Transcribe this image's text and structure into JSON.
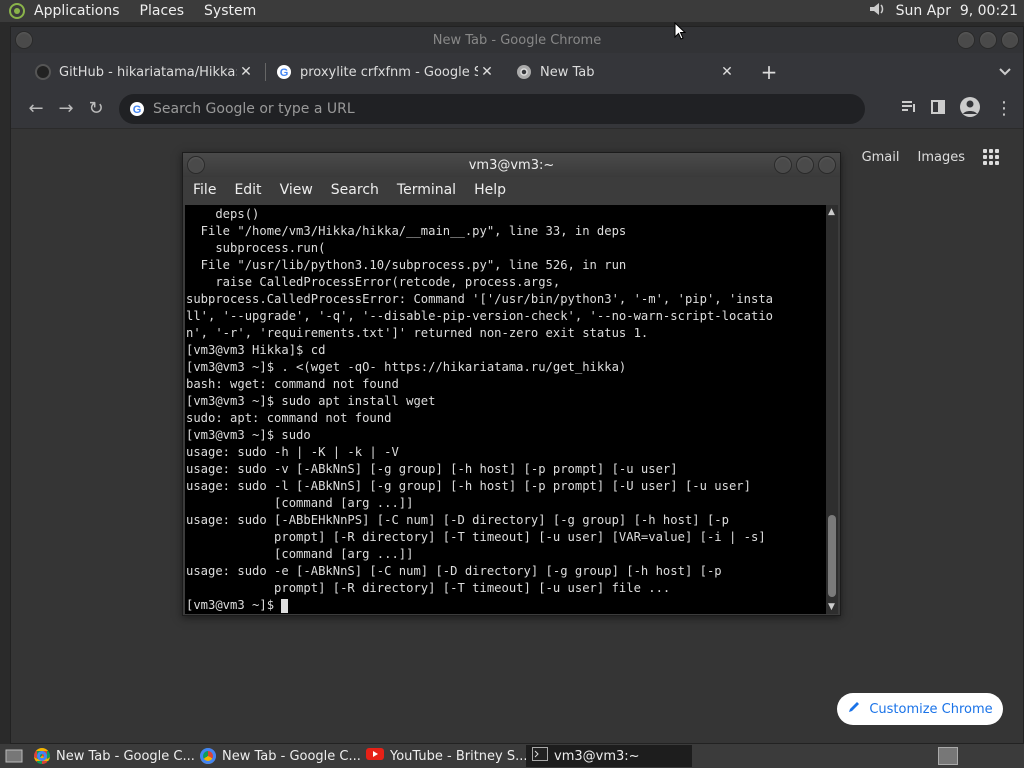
{
  "top_panel": {
    "menus": [
      "Applications",
      "Places",
      "System"
    ],
    "clock": "Sun Apr  9, 00:21"
  },
  "chrome": {
    "window_title": "New Tab - Google Chrome",
    "tabs": [
      {
        "label": "GitHub - hikariatama/Hikka: Tl",
        "icon": "github-icon"
      },
      {
        "label": "proxylite crfxfnm - Google Sea",
        "icon": "google-icon"
      },
      {
        "label": "New Tab",
        "icon": "chrome-icon"
      }
    ],
    "omnibox_placeholder": "Search Google or type a URL",
    "links": {
      "gmail": "Gmail",
      "images": "Images"
    },
    "customize_label": "Customize Chrome"
  },
  "terminal": {
    "title": "vm3@vm3:~",
    "menu": [
      "File",
      "Edit",
      "View",
      "Search",
      "Terminal",
      "Help"
    ],
    "lines": [
      "    deps()",
      "  File \"/home/vm3/Hikka/hikka/__main__.py\", line 33, in deps",
      "    subprocess.run(",
      "  File \"/usr/lib/python3.10/subprocess.py\", line 526, in run",
      "    raise CalledProcessError(retcode, process.args,",
      "subprocess.CalledProcessError: Command '['/usr/bin/python3', '-m', 'pip', 'insta",
      "ll', '--upgrade', '-q', '--disable-pip-version-check', '--no-warn-script-locatio",
      "n', '-r', 'requirements.txt']' returned non-zero exit status 1.",
      "[vm3@vm3 Hikka]$ cd",
      "[vm3@vm3 ~]$ . <(wget -qO- https://hikariatama.ru/get_hikka)",
      "bash: wget: command not found",
      "[vm3@vm3 ~]$ sudo apt install wget",
      "sudo: apt: command not found",
      "[vm3@vm3 ~]$ sudo",
      "usage: sudo -h | -K | -k | -V",
      "usage: sudo -v [-ABkNnS] [-g group] [-h host] [-p prompt] [-u user]",
      "usage: sudo -l [-ABkNnS] [-g group] [-h host] [-p prompt] [-U user] [-u user]",
      "            [command [arg ...]]",
      "usage: sudo [-ABbEHkNnPS] [-C num] [-D directory] [-g group] [-h host] [-p",
      "            prompt] [-R directory] [-T timeout] [-u user] [VAR=value] [-i | -s]",
      "            [command [arg ...]]",
      "usage: sudo -e [-ABkNnS] [-C num] [-D directory] [-g group] [-h host] [-p",
      "            prompt] [-R directory] [-T timeout] [-u user] file ..."
    ],
    "prompt": "[vm3@vm3 ~]$ "
  },
  "taskbar": {
    "items": [
      {
        "label": "New Tab - Google C...",
        "icon": "chrome-icon"
      },
      {
        "label": "New Tab - Google C...",
        "icon": "chrome-icon"
      },
      {
        "label": "YouTube - Britney S...",
        "icon": "youtube-icon"
      },
      {
        "label": "vm3@vm3:~",
        "icon": "terminal-icon"
      }
    ]
  }
}
